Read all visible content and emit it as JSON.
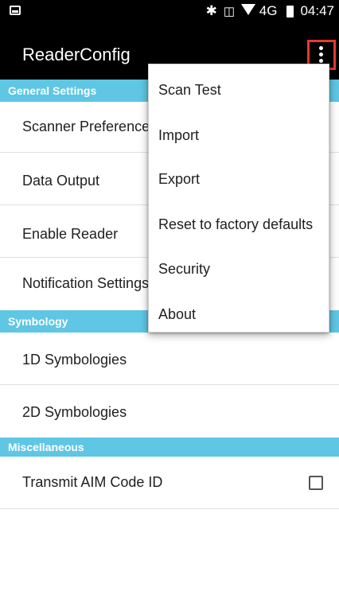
{
  "status_bar": {
    "time": "04:47",
    "network": "4G",
    "icons": [
      "screenshot-icon",
      "bluetooth-icon",
      "vibrate-icon",
      "signal-icon",
      "battery-icon"
    ]
  },
  "app_bar": {
    "title": "ReaderConfig",
    "overflow_icon": "more-vert-icon"
  },
  "sections": {
    "general": "General Settings",
    "symbology": "Symbology",
    "misc": "Miscellaneous"
  },
  "rows": {
    "scanner_prefs": "Scanner Preferences",
    "data_output": "Data Output",
    "enable_reader": "Enable Reader",
    "notification": "Notification Settings",
    "sym1d": "1D Symbologies",
    "sym2d": "2D Symbologies",
    "aim": "Transmit AIM Code ID"
  },
  "checkbox": {
    "aim_checked": false
  },
  "menu": {
    "items": [
      "Scan Test",
      "Import",
      "Export",
      "Reset to factory defaults",
      "Security",
      "About"
    ]
  },
  "colors": {
    "section_bg": "#5fc6e4",
    "highlight": "#e53935",
    "appbar_bg": "#000000"
  }
}
